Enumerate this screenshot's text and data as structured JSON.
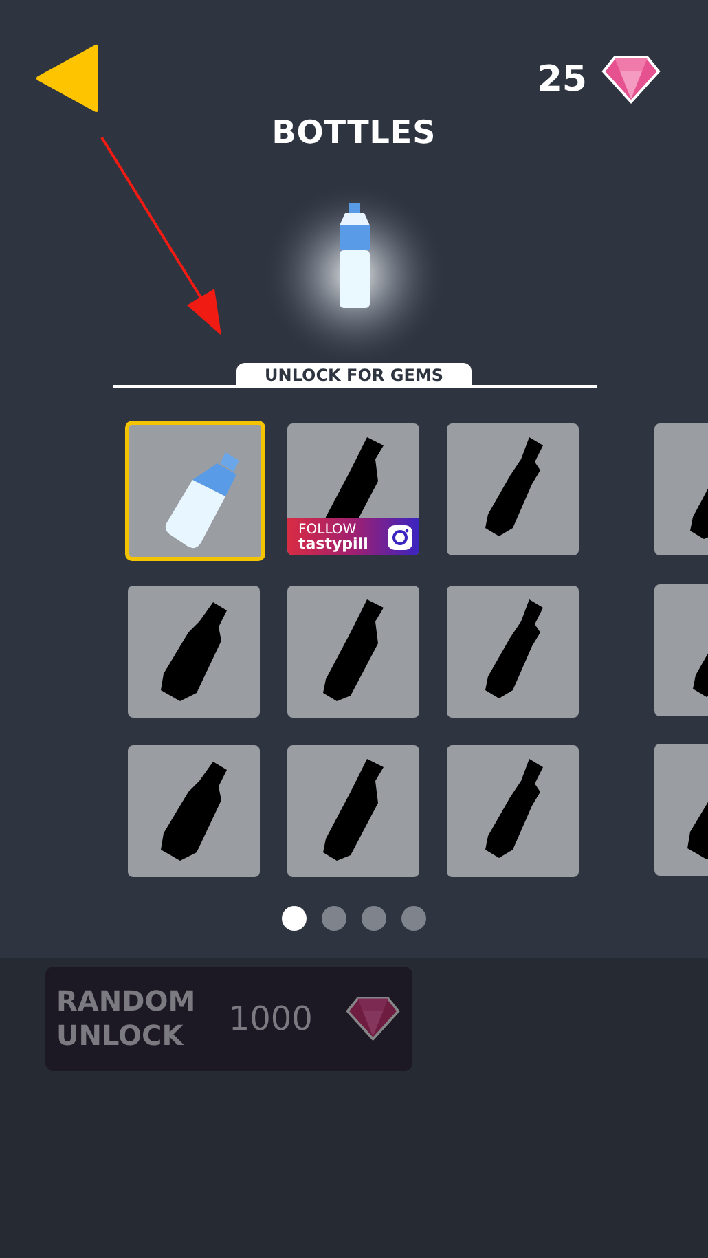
{
  "header": {
    "gem_count": "25",
    "title": "BOTTLES"
  },
  "unlock_label": "UNLOCK FOR GEMS",
  "tiles": [
    {
      "kind": "unlocked",
      "selected": true
    },
    {
      "kind": "follow",
      "selected": false,
      "follow_label": "FOLLOW",
      "follow_handle": "tastypill"
    },
    {
      "kind": "locked",
      "selected": false
    },
    {
      "kind": "locked",
      "selected": false
    },
    {
      "kind": "locked",
      "selected": false
    },
    {
      "kind": "locked",
      "selected": false
    },
    {
      "kind": "locked",
      "selected": false
    },
    {
      "kind": "locked",
      "selected": false
    },
    {
      "kind": "locked",
      "selected": false
    }
  ],
  "next_page_tiles": [
    {
      "kind": "locked",
      "selected": false
    },
    {
      "kind": "locked",
      "selected": false
    },
    {
      "kind": "locked",
      "selected": false
    }
  ],
  "pages": [
    {
      "selected": true
    },
    {
      "selected": false
    },
    {
      "selected": false
    },
    {
      "selected": false
    }
  ],
  "random_unlock": {
    "label": "RANDOM UNLOCK",
    "price": "1000"
  }
}
